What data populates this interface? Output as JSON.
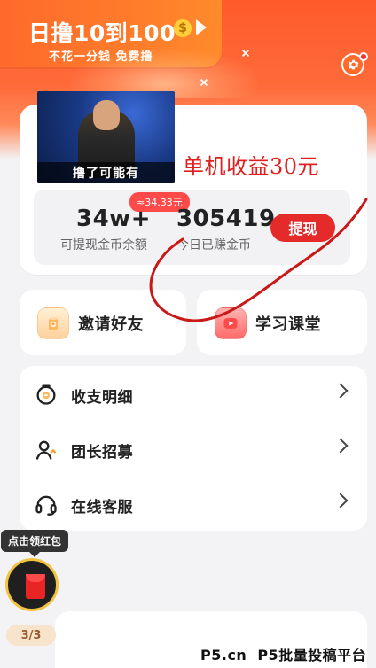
{
  "promo": {
    "title": "日撸10到100",
    "coin_symbol": "$",
    "subtitle": "不花一分钱 免费撸"
  },
  "overlay": {
    "video_caption": "撸了可能有",
    "red_text": "单机收益30元"
  },
  "earnings": {
    "badge": "≈34.33元",
    "withdrawable_value": "34w+",
    "withdrawable_label": "可提现金币余额",
    "today_value": "305419",
    "today_label": "今日已赚金币",
    "withdraw_button": "提现"
  },
  "quick_actions": [
    {
      "label": "邀请好友",
      "icon": "coin-jar-icon"
    },
    {
      "label": "学习课堂",
      "icon": "play-icon"
    }
  ],
  "menu": [
    {
      "label": "收支明细",
      "icon": "wallet-icon"
    },
    {
      "label": "团长招募",
      "icon": "users-icon"
    },
    {
      "label": "在线客服",
      "icon": "headset-icon"
    }
  ],
  "floating": {
    "tooltip": "点击领红包",
    "counter": "3/3"
  },
  "watermark": {
    "left": "P5.cn",
    "right": "P5批量投稿平台"
  },
  "colors": {
    "header_orange": "#ff5a2a",
    "primary_red": "#e52a2a",
    "background": "#f3f3f6"
  }
}
